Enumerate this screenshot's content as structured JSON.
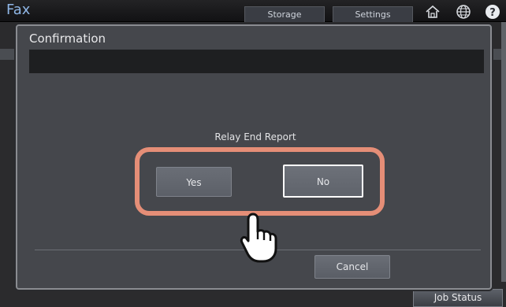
{
  "app": {
    "title": "Fax",
    "tabs": [
      {
        "label": "Storage"
      },
      {
        "label": "Settings"
      }
    ],
    "job_status_label": "Job Status"
  },
  "icons": {
    "home": "home-icon",
    "globe": "globe-icon",
    "help": "help-icon",
    "pointer": "pointing-hand-icon"
  },
  "dialog": {
    "title": "Confirmation",
    "message": "",
    "prompt": "Relay End Report",
    "yes_label": "Yes",
    "no_label": "No",
    "cancel_label": "Cancel",
    "selected": "No"
  },
  "colors": {
    "highlight": "#e58e77",
    "app_title": "#8fb6e6",
    "dialog_bg": "#45474c"
  }
}
